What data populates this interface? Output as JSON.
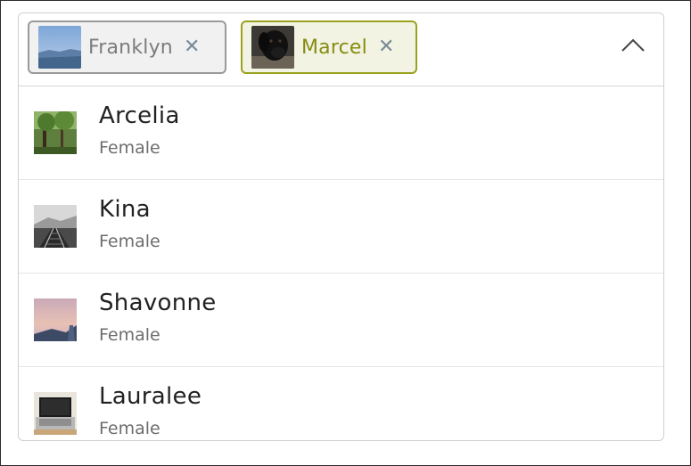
{
  "selected": [
    {
      "label": "Franklyn",
      "remove_glyph": "✕",
      "thumbnail": "blue-sky-landscape"
    },
    {
      "label": "Marcel",
      "remove_glyph": "✕",
      "thumbnail": "black-dog"
    }
  ],
  "toggle_icon": "chevron-up-icon",
  "options": [
    {
      "name": "Arcelia",
      "subtitle": "Female",
      "thumbnail": "forest-trees"
    },
    {
      "name": "Kina",
      "subtitle": "Female",
      "thumbnail": "railway-tracks"
    },
    {
      "name": "Shavonne",
      "subtitle": "Female",
      "thumbnail": "pink-sunset-sky"
    },
    {
      "name": "Lauralee",
      "subtitle": "Female",
      "thumbnail": "laptop"
    }
  ],
  "colors": {
    "chip_default_border": "#9a9a9a",
    "chip_focused_border": "#9aa21d",
    "chip_focused_text": "#868c12",
    "remove_icon": "#7a8a99"
  }
}
